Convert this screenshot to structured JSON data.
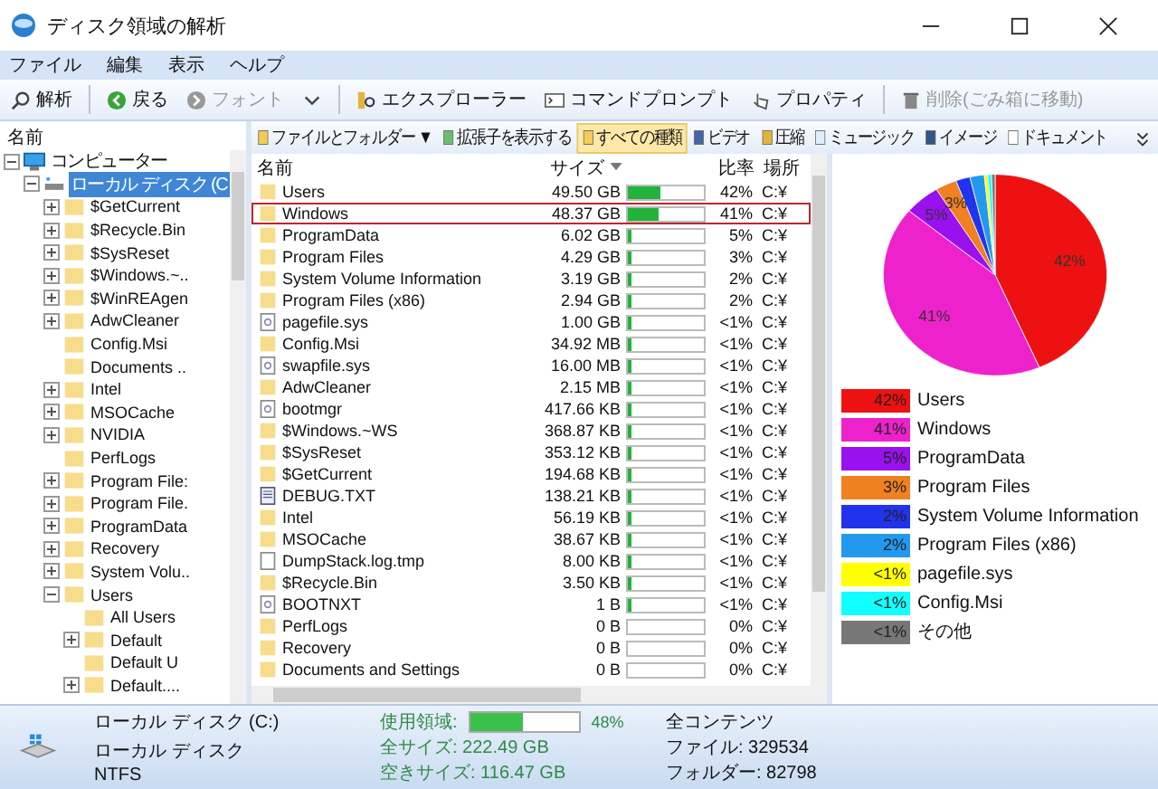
{
  "window": {
    "title": "ディスク領域の解析"
  },
  "menu": [
    "ファイル",
    "編集",
    "表示",
    "ヘルプ"
  ],
  "toolbar": [
    [
      {
        "label": "解析",
        "disabled": false
      }
    ],
    [
      {
        "label": "戻る",
        "disabled": false
      },
      {
        "label": "フォント",
        "disabled": true
      },
      {
        "kind": "dropdown"
      }
    ],
    [
      {
        "label": "エクスプローラー",
        "disabled": false
      },
      {
        "label": "コマンドプロンプト",
        "disabled": false
      },
      {
        "label": "プロパティ",
        "disabled": false
      }
    ],
    [
      {
        "label": "削除(ごみ箱に移動)",
        "disabled": true
      }
    ]
  ],
  "tree": {
    "header": "名前",
    "items": [
      {
        "label": "コンピューター",
        "kind": "computer",
        "expanded": true,
        "selected": false,
        "children": [
          {
            "label": "ローカル ディスク (C",
            "kind": "drive",
            "expanded": true,
            "selected": true,
            "children": [
              {
                "label": "$GetCurrent",
                "kind": "folder",
                "expanded": false,
                "selected": false
              },
              {
                "label": "$Recycle.Bin",
                "kind": "folder",
                "expanded": false,
                "selected": false
              },
              {
                "label": "$SysReset",
                "kind": "folder",
                "expanded": false,
                "selected": false
              },
              {
                "label": "$Windows.~..",
                "kind": "folder",
                "expanded": false,
                "selected": false
              },
              {
                "label": "$WinREAgen",
                "kind": "folder",
                "expanded": false,
                "selected": false
              },
              {
                "label": "AdwCleaner",
                "kind": "folder",
                "expanded": false,
                "selected": false
              },
              {
                "label": "Config.Msi",
                "kind": "folder",
                "selected": false
              },
              {
                "label": "Documents ..",
                "kind": "folder",
                "selected": false
              },
              {
                "label": "Intel",
                "kind": "folder",
                "expanded": false,
                "selected": false
              },
              {
                "label": "MSOCache",
                "kind": "folder",
                "expanded": false,
                "selected": false
              },
              {
                "label": "NVIDIA",
                "kind": "folder",
                "expanded": false,
                "selected": false
              },
              {
                "label": "PerfLogs",
                "kind": "folder",
                "selected": false
              },
              {
                "label": "Program File:",
                "kind": "folder",
                "expanded": false,
                "selected": false
              },
              {
                "label": "Program File.",
                "kind": "folder",
                "expanded": false,
                "selected": false
              },
              {
                "label": "ProgramData",
                "kind": "folder",
                "expanded": false,
                "selected": false
              },
              {
                "label": "Recovery",
                "kind": "folder",
                "expanded": false,
                "selected": false
              },
              {
                "label": "System Volu..",
                "kind": "folder",
                "expanded": false,
                "selected": false
              },
              {
                "label": "Users",
                "kind": "folder",
                "expanded": true,
                "selected": false,
                "children": [
                  {
                    "label": "All Users",
                    "kind": "folder",
                    "selected": false
                  },
                  {
                    "label": "Default",
                    "kind": "folder",
                    "expanded": false,
                    "selected": false
                  },
                  {
                    "label": "Default U",
                    "kind": "folder",
                    "selected": false
                  },
                  {
                    "label": "Default....",
                    "kind": "folder",
                    "expanded": false,
                    "selected": false
                  }
                ]
              }
            ]
          }
        ]
      }
    ]
  },
  "filters": [
    {
      "label": "ファイルとフォルダー ▼",
      "selected": false
    },
    {
      "label": "拡張子を表示する",
      "selected": false
    },
    {
      "label": "すべての種類",
      "selected": true
    },
    {
      "label": "ビデオ",
      "selected": false
    },
    {
      "label": "圧縮",
      "selected": false
    },
    {
      "label": "ミュージック",
      "selected": false
    },
    {
      "label": "イメージ",
      "selected": false
    },
    {
      "label": "ドキュメント",
      "selected": false
    }
  ],
  "table": {
    "columns": [
      "名前",
      "サイズ",
      "比率",
      "場所"
    ],
    "rows": [
      {
        "name": "Users",
        "kind": "folder",
        "size": "49.50 GB",
        "level": 0.42,
        "ratio": "42%",
        "location": "C:¥",
        "selected": false
      },
      {
        "name": "Windows",
        "kind": "folder",
        "size": "48.37 GB",
        "level": 0.41,
        "ratio": "41%",
        "location": "C:¥",
        "selected": true
      },
      {
        "name": "ProgramData",
        "kind": "folder",
        "size": "6.02 GB",
        "level": 0.05,
        "ratio": "5%",
        "location": "C:¥",
        "selected": false
      },
      {
        "name": "Program Files",
        "kind": "folder",
        "size": "4.29 GB",
        "level": 0.03,
        "ratio": "3%",
        "location": "C:¥",
        "selected": false
      },
      {
        "name": "System Volume Information",
        "kind": "folder",
        "size": "3.19 GB",
        "level": 0.02,
        "ratio": "2%",
        "location": "C:¥",
        "selected": false
      },
      {
        "name": "Program Files (x86)",
        "kind": "folder",
        "size": "2.94 GB",
        "level": 0.02,
        "ratio": "2%",
        "location": "C:¥",
        "selected": false
      },
      {
        "name": "pagefile.sys",
        "kind": "file",
        "size": "1.00 GB",
        "level": 0.01,
        "ratio": "<1%",
        "location": "C:¥",
        "selected": false
      },
      {
        "name": "Config.Msi",
        "kind": "folder",
        "size": "34.92 MB",
        "level": 0.01,
        "ratio": "<1%",
        "location": "C:¥",
        "selected": false
      },
      {
        "name": "swapfile.sys",
        "kind": "file",
        "size": "16.00 MB",
        "level": 0.01,
        "ratio": "<1%",
        "location": "C:¥",
        "selected": false
      },
      {
        "name": "AdwCleaner",
        "kind": "folder",
        "size": "2.15 MB",
        "level": 0.01,
        "ratio": "<1%",
        "location": "C:¥",
        "selected": false
      },
      {
        "name": "bootmgr",
        "kind": "file",
        "size": "417.66 KB",
        "level": 0.01,
        "ratio": "<1%",
        "location": "C:¥",
        "selected": false
      },
      {
        "name": "$Windows.~WS",
        "kind": "folder",
        "size": "368.87 KB",
        "level": 0.01,
        "ratio": "<1%",
        "location": "C:¥",
        "selected": false
      },
      {
        "name": "$SysReset",
        "kind": "folder",
        "size": "353.12 KB",
        "level": 0.01,
        "ratio": "<1%",
        "location": "C:¥",
        "selected": false
      },
      {
        "name": "$GetCurrent",
        "kind": "folder",
        "size": "194.68 KB",
        "level": 0.01,
        "ratio": "<1%",
        "location": "C:¥",
        "selected": false
      },
      {
        "name": "DEBUG.TXT",
        "kind": "text",
        "size": "138.21 KB",
        "level": 0.01,
        "ratio": "<1%",
        "location": "C:¥",
        "selected": false
      },
      {
        "name": "Intel",
        "kind": "folder",
        "size": "56.19 KB",
        "level": 0.01,
        "ratio": "<1%",
        "location": "C:¥",
        "selected": false
      },
      {
        "name": "MSOCache",
        "kind": "folder",
        "size": "38.67 KB",
        "level": 0.01,
        "ratio": "<1%",
        "location": "C:¥",
        "selected": false
      },
      {
        "name": "DumpStack.log.tmp",
        "kind": "blank",
        "size": "8.00 KB",
        "level": 0.01,
        "ratio": "<1%",
        "location": "C:¥",
        "selected": false
      },
      {
        "name": "$Recycle.Bin",
        "kind": "folder",
        "size": "3.50 KB",
        "level": 0.01,
        "ratio": "<1%",
        "location": "C:¥",
        "selected": false
      },
      {
        "name": "BOOTNXT",
        "kind": "file",
        "size": "1 B",
        "level": 0.01,
        "ratio": "<1%",
        "location": "C:¥",
        "selected": false
      },
      {
        "name": "PerfLogs",
        "kind": "folder",
        "size": "0 B",
        "level": 0,
        "ratio": "0%",
        "location": "C:¥",
        "selected": false
      },
      {
        "name": "Recovery",
        "kind": "folder",
        "size": "0 B",
        "level": 0,
        "ratio": "0%",
        "location": "C:¥",
        "selected": false
      },
      {
        "name": "Documents and Settings",
        "kind": "folder",
        "size": "0 B",
        "level": 0,
        "ratio": "0%",
        "location": "C:¥",
        "selected": false
      }
    ]
  },
  "pie": {
    "chart_data": {
      "type": "pie",
      "categories": [
        "Users",
        "Windows",
        "ProgramData",
        "Program Files",
        "System Volume Information",
        "Program Files (x86)",
        "pagefile.sys",
        "Config.Msi",
        "その他"
      ],
      "values": [
        42,
        41,
        5,
        3,
        2,
        2,
        0.5,
        0.5,
        0.5
      ],
      "value_labels": [
        "42%",
        "41%",
        "5%",
        "3%",
        null,
        null,
        null,
        null,
        null
      ]
    },
    "legend": [
      {
        "percent": "42%",
        "color": "#ee1111"
      },
      {
        "percent": "41%",
        "color": "#ee22cc"
      },
      {
        "percent": "5%",
        "color": "#9911ee"
      },
      {
        "percent": "3%",
        "color": "#f08020"
      },
      {
        "percent": "2%",
        "color": "#2233ee"
      },
      {
        "percent": "2%",
        "color": "#2299ee"
      },
      {
        "percent": "<1%",
        "color": "#ffff00"
      },
      {
        "percent": "<1%",
        "color": "#11ffff"
      },
      {
        "percent": "<1%",
        "color": "#777777"
      }
    ]
  },
  "status": {
    "drive": [
      "ローカル ディスク (C:)",
      "ローカル ディスク",
      "NTFS"
    ],
    "usage_label": "使用領域:",
    "usage": {
      "level": 0.48,
      "reading": "48%"
    },
    "sizes": [
      "全サイズ: 222.49 GB",
      "空きサイズ: 116.47 GB"
    ],
    "contents": [
      "全コンテンツ",
      "ファイル: 329534",
      "フォルダー: 82798"
    ]
  }
}
